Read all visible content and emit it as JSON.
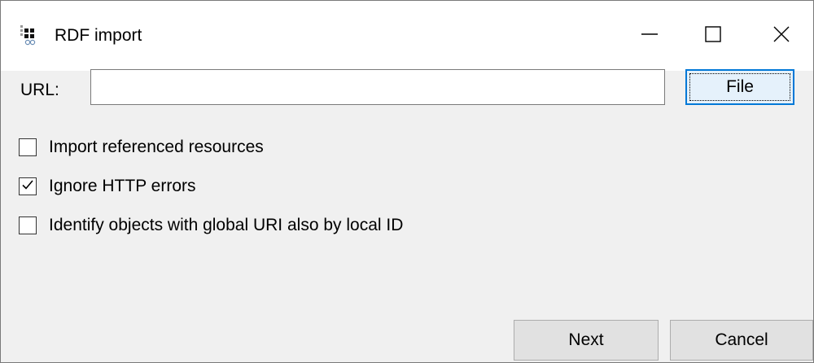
{
  "window": {
    "title": "RDF import",
    "icon": "rdf-app-icon"
  },
  "titlebar_controls": {
    "minimize_icon": "minimize-icon",
    "maximize_icon": "maximize-icon",
    "close_icon": "close-icon"
  },
  "url": {
    "label": "URL:",
    "value": "",
    "placeholder": ""
  },
  "file_button": {
    "label": "File"
  },
  "options": [
    {
      "label": "Import referenced resources",
      "checked": false
    },
    {
      "label": "Ignore HTTP errors",
      "checked": true
    },
    {
      "label": "Identify objects with global URI also by local ID",
      "checked": false
    }
  ],
  "buttons": {
    "next": "Next",
    "cancel": "Cancel"
  },
  "colors": {
    "focus_accent": "#0078d7",
    "dialog_background": "#f0f0f0"
  }
}
